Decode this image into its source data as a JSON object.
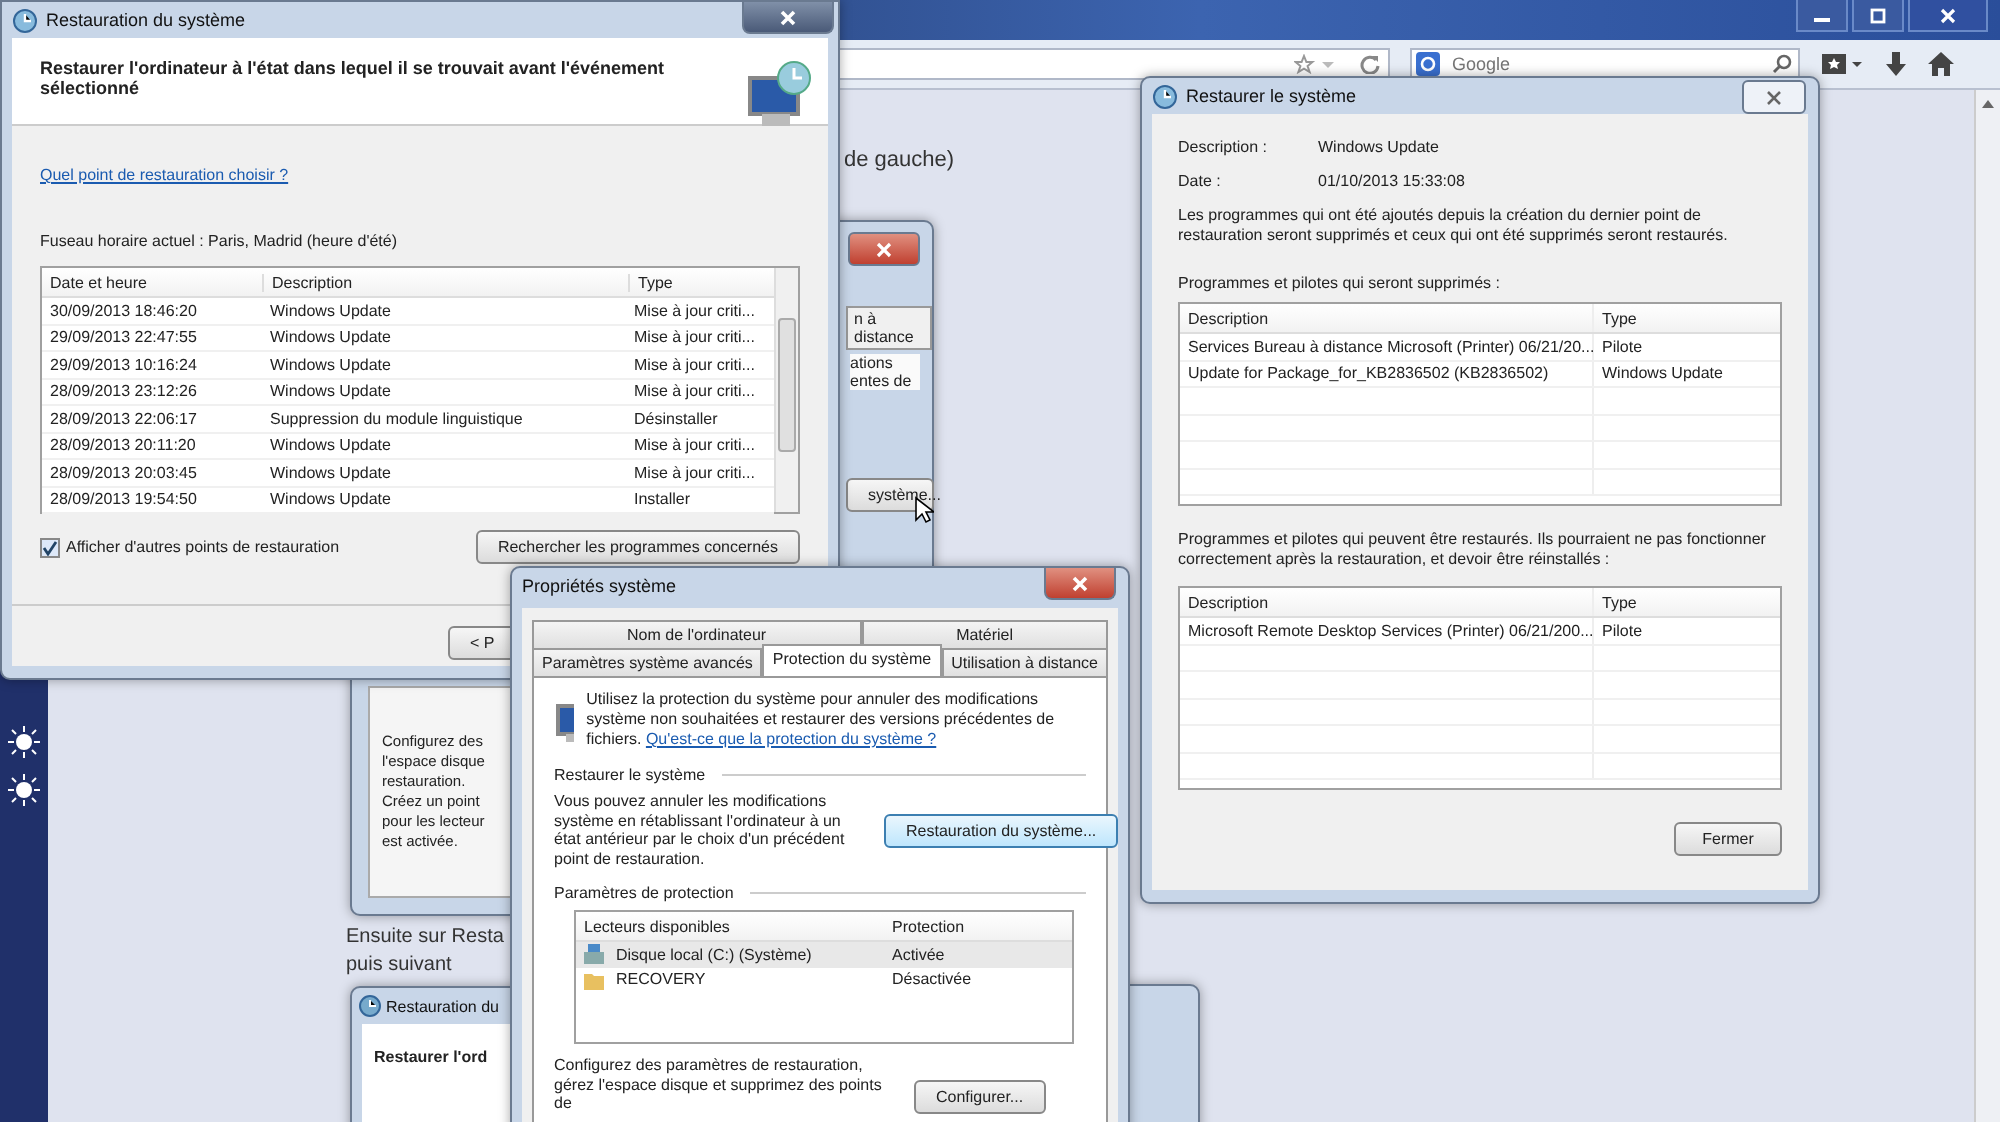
{
  "browser": {
    "search_placeholder": "Google"
  },
  "page": {
    "texts": [
      "de gauche)",
      "Ensuite sur Resta",
      "puis suivant"
    ]
  },
  "background_window": {
    "tab": "n à distance",
    "lines": [
      "ations",
      "entes de"
    ],
    "button": "système...",
    "notes": [
      "Configurez des",
      "l'espace disque",
      "restauration.",
      "Créez un point",
      "pour les lecteur",
      "est activée."
    ]
  },
  "bottom_window": {
    "title": "Restauration du",
    "heading": "Restaurer l'ord"
  },
  "restore_wizard": {
    "title": "Restauration du système",
    "heading": "Restaurer l'ordinateur à l'état dans lequel il se trouvait avant l'événement sélectionné",
    "link": "Quel point de restauration choisir ?",
    "timezone": "Fuseau horaire actuel : Paris, Madrid (heure d'été)",
    "columns": [
      "Date et heure",
      "Description",
      "Type"
    ],
    "rows": [
      {
        "date": "30/09/2013 18:46:20",
        "description": "Windows Update",
        "type": "Mise à jour criti..."
      },
      {
        "date": "29/09/2013 22:47:55",
        "description": "Windows Update",
        "type": "Mise à jour criti..."
      },
      {
        "date": "29/09/2013 10:16:24",
        "description": "Windows Update",
        "type": "Mise à jour criti..."
      },
      {
        "date": "28/09/2013 23:12:26",
        "description": "Windows Update",
        "type": "Mise à jour criti..."
      },
      {
        "date": "28/09/2013 22:06:17",
        "description": "Suppression du module linguistique",
        "type": "Désinstaller"
      },
      {
        "date": "28/09/2013 20:11:20",
        "description": "Windows Update",
        "type": "Mise à jour criti..."
      },
      {
        "date": "28/09/2013 20:03:45",
        "description": "Windows Update",
        "type": "Mise à jour criti..."
      },
      {
        "date": "28/09/2013 19:54:50",
        "description": "Windows Update",
        "type": "Installer"
      }
    ],
    "show_more": {
      "label": "Afficher d'autres points de restauration",
      "checked": true
    },
    "search_button": "Rechercher les programmes concernés",
    "back_button": "< P"
  },
  "restore_details": {
    "title": "Restaurer le système",
    "fields": [
      {
        "label": "Description :",
        "value": "Windows Update"
      },
      {
        "label": "Date :",
        "value": "01/10/2013 15:33:08"
      }
    ],
    "intro": "Les programmes qui ont été ajoutés depuis la création du dernier point de restauration seront supprimés et ceux qui ont été supprimés seront restaurés.",
    "removed_label": "Programmes et pilotes qui seront supprimés :",
    "removed_columns": [
      "Description",
      "Type"
    ],
    "removed_rows": [
      {
        "description": "Services Bureau à distance Microsoft (Printer) 06/21/20...",
        "type": "Pilote"
      },
      {
        "description": "Update for Package_for_KB2836502 (KB2836502)",
        "type": "Windows Update"
      }
    ],
    "restored_label": "Programmes et pilotes qui peuvent être restaurés. Ils pourraient ne pas fonctionner correctement après la restauration, et devoir être réinstallés :",
    "restored_columns": [
      "Description",
      "Type"
    ],
    "restored_rows": [
      {
        "description": "Microsoft Remote Desktop Services (Printer) 06/21/200...",
        "type": "Pilote"
      }
    ],
    "close_button": "Fermer"
  },
  "system_properties": {
    "title": "Propriétés système",
    "tab_rows": [
      [
        {
          "label": "Nom de l'ordinateur",
          "selected": false
        },
        {
          "label": "Matériel",
          "selected": false
        }
      ],
      [
        {
          "label": "Paramètres système avancés",
          "selected": false
        },
        {
          "label": "Protection du système",
          "selected": true
        },
        {
          "label": "Utilisation à distance",
          "selected": false
        }
      ]
    ],
    "intro": "Utilisez la protection du système pour annuler des modifications système non souhaitées et restaurer des versions précédentes de fichiers.",
    "intro_link": "Qu'est-ce que la protection du système ?",
    "restore_group": "Restaurer le système",
    "restore_text": "Vous pouvez annuler les modifications système en rétablissant l'ordinateur à un état antérieur par le choix d'un précédent point de restauration.",
    "restore_button": "Restauration du système...",
    "protection_group": "Paramètres de protection",
    "drive_columns": [
      "Lecteurs disponibles",
      "Protection"
    ],
    "drives": [
      {
        "name": "Disque local (C:) (Système)",
        "protection": "Activée",
        "kind": "disk",
        "selected": true
      },
      {
        "name": "RECOVERY",
        "protection": "Désactivée",
        "kind": "folder",
        "selected": false
      }
    ],
    "configure_text": "Configurez des paramètres de restauration, gérez l'espace disque et supprimez des points de",
    "configure_button": "Configurer..."
  }
}
